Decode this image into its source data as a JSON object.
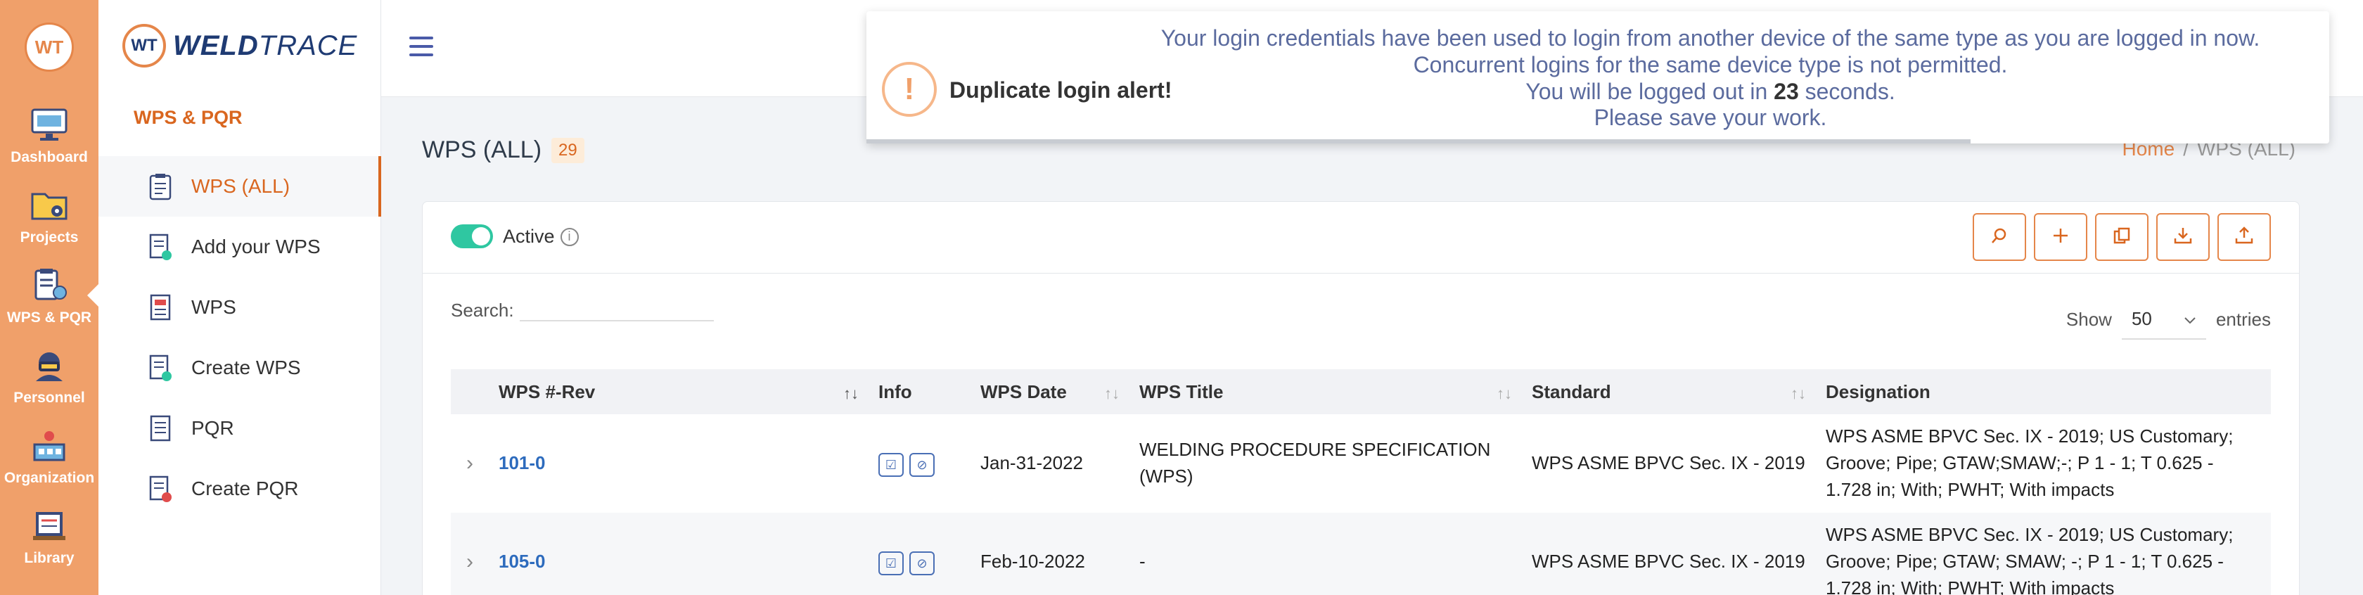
{
  "rail": {
    "logo_text": "WT",
    "items": [
      {
        "label": "Dashboard",
        "icon": "dashboard-icon"
      },
      {
        "label": "Projects",
        "icon": "projects-icon"
      },
      {
        "label": "WPS & PQR",
        "icon": "wps-pqr-icon"
      },
      {
        "label": "Personnel",
        "icon": "personnel-icon"
      },
      {
        "label": "Organization",
        "icon": "organization-icon"
      },
      {
        "label": "Library",
        "icon": "library-icon"
      }
    ]
  },
  "brand": {
    "mark": "WT",
    "name_bold": "WELD",
    "name_rest": "TRACE"
  },
  "subnav": {
    "section_title": "WPS & PQR",
    "items": [
      {
        "label": "WPS (ALL)",
        "icon": "clipboard-icon"
      },
      {
        "label": "Add your WPS",
        "icon": "add-document-icon"
      },
      {
        "label": "WPS",
        "icon": "document-icon"
      },
      {
        "label": "Create WPS",
        "icon": "create-document-icon"
      },
      {
        "label": "PQR",
        "icon": "pqr-document-icon"
      },
      {
        "label": "Create PQR",
        "icon": "create-pqr-icon"
      }
    ]
  },
  "page": {
    "title": "WPS (ALL)",
    "count": "29",
    "breadcrumb": {
      "home": "Home",
      "sep": "/",
      "current": "WPS (ALL)"
    }
  },
  "card": {
    "active_label": "Active",
    "info_glyph": "i",
    "search_label": "Search:",
    "search_value": "",
    "show_label": "Show",
    "entries_value": "50",
    "entries_label": "entries"
  },
  "table": {
    "columns": [
      "WPS #-Rev",
      "Info",
      "WPS Date",
      "WPS Title",
      "Standard",
      "Designation"
    ],
    "rows": [
      {
        "wps": "101-0",
        "date": "Jan-31-2022",
        "title": "WELDING PROCEDURE SPECIFICATION (WPS)",
        "standard": "WPS ASME BPVC Sec. IX - 2019",
        "designation": "WPS ASME BPVC Sec. IX - 2019; US Customary; Groove; Pipe; GTAW;SMAW;-; P 1 - 1; T 0.625 - 1.728 in; With; PWHT; With impacts"
      },
      {
        "wps": "105-0",
        "date": "Feb-10-2022",
        "title": "-",
        "standard": "WPS ASME BPVC Sec. IX - 2019",
        "designation": "WPS ASME BPVC Sec. IX - 2019; US Customary; Groove; Pipe; GTAW; SMAW; -; P 1 - 1; T 0.625 - 1.728 in; With; PWHT; With impacts"
      }
    ]
  },
  "alert": {
    "title": "Duplicate login alert!",
    "line1": "Your login credentials have been used to login from another device of the same type as you are logged in now.",
    "line2": "Concurrent logins for the same device type is not permitted.",
    "line3_pre": "You will be logged out in",
    "seconds": "23",
    "line3_post": "seconds.",
    "line4": "Please save your work.",
    "progress": 0.755
  },
  "colors": {
    "accent": "#d9661f",
    "rail": "#f0a06a",
    "link": "#2d6bbd",
    "toggle": "#2fc7a1",
    "alert_text": "#5b6b9e"
  }
}
